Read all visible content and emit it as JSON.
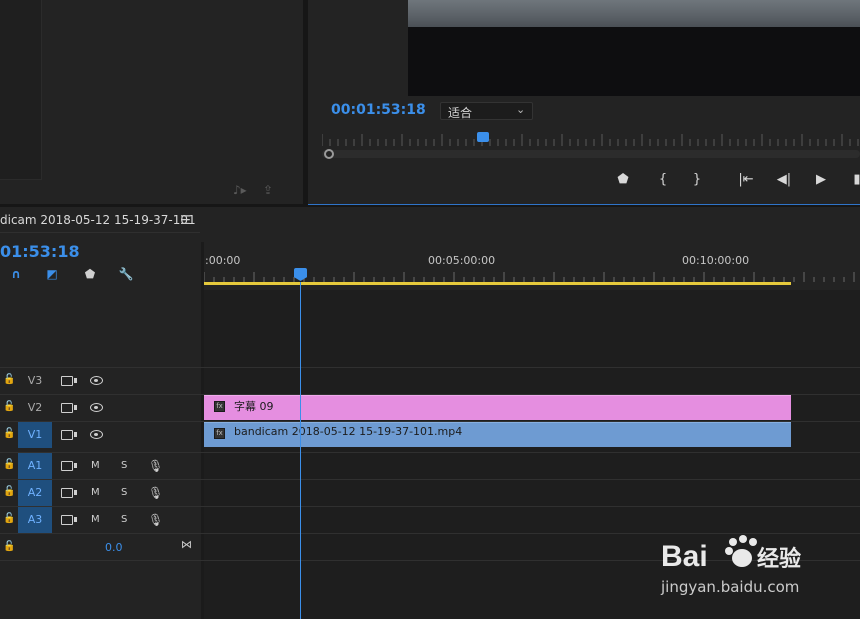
{
  "program_monitor": {
    "timecode": "00:01:53:18",
    "fit_dropdown": {
      "selected": "适合",
      "chevron_icon": "chevron-down-icon"
    },
    "transport_icons": [
      "add-marker-icon",
      "mark-in-icon",
      "mark-out-icon",
      "go-to-in-icon",
      "step-back-icon",
      "play-icon",
      "step-forward-icon"
    ],
    "playhead_fraction": 0.29
  },
  "source_monitor": {
    "icons": [
      "drag-audio-icon",
      "export-frame-icon"
    ]
  },
  "timeline": {
    "sequence_name": "dicam 2018-05-12 15-19-37-101",
    "timecode": "01:53:18",
    "tool_icons": [
      "snap-icon",
      "linked-selection-icon",
      "add-marker-icon",
      "wrench-icon"
    ],
    "ruler_labels": [
      ":00:00",
      "00:05:00:00",
      "00:10:00:00"
    ],
    "tracks": {
      "video": [
        {
          "name": "V3",
          "active": false
        },
        {
          "name": "V2",
          "active": false
        },
        {
          "name": "V1",
          "active": true
        }
      ],
      "audio": [
        {
          "name": "A1",
          "mute": "M",
          "solo": "S"
        },
        {
          "name": "A2",
          "mute": "M",
          "solo": "S"
        },
        {
          "name": "A3",
          "mute": "M",
          "solo": "S"
        }
      ],
      "master_volume": "0.0"
    },
    "clips": {
      "subtitle": {
        "label": "字幕 09",
        "color": "#e58ee0",
        "fx": "fx"
      },
      "video": {
        "label": "bandicam 2018-05-12 15-19-37-101.mp4",
        "color": "#6e9bd2",
        "fx": "fx"
      }
    },
    "colors": {
      "accent": "#3b8fea",
      "work_area": "#e5c93c"
    }
  },
  "watermark": {
    "logo": "Bai du 经验",
    "url": "jingyan.baidu.com"
  }
}
